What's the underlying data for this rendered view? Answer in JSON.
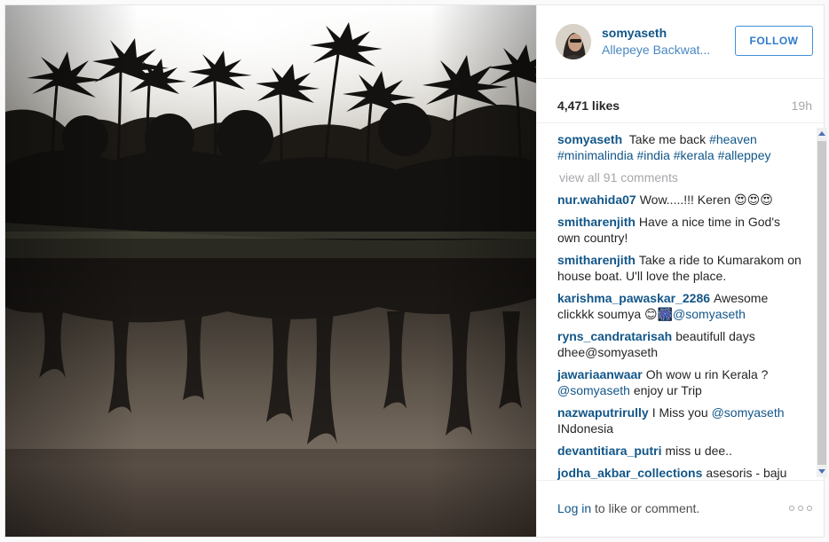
{
  "post": {
    "photo_alt": "Allepeye backwater palm trees reflection",
    "username": "somyaseth",
    "location": "Allepeye Backwat...",
    "follow_label": "FOLLOW",
    "likes": "4,471 likes",
    "time": "19h"
  },
  "caption": {
    "user": "somyaseth",
    "text_before": "Take me back",
    "tags": [
      "#heaven",
      "#minimalindia",
      "#india",
      "#kerala",
      "#alleppey"
    ]
  },
  "view_all": "view all 91 comments",
  "comments": [
    {
      "user": "nur.wahida07",
      "text": "Wow.....!!! Keren 😍😍😍",
      "mention": ""
    },
    {
      "user": "smitharenjith",
      "text": "Have a nice time in God's own country!",
      "mention": ""
    },
    {
      "user": "smitharenjith",
      "text": "Take a ride to Kumarakom on house boat. U'll love the place.",
      "mention": ""
    },
    {
      "user": "karishma_pawaskar_2286",
      "text": "Awesome clickkk soumya 😊🎆",
      "mention": "@somyaseth"
    },
    {
      "user": "ryns_candratarisah",
      "text": "beautifull days dhee@somyaseth",
      "mention": ""
    },
    {
      "user": "jawariaanwaar",
      "text": "Oh wow u rin Kerala ?",
      "mention": "@somyaseth",
      "after": "enjoy ur Trip"
    },
    {
      "user": "nazwaputrirully",
      "text": "I Miss you",
      "mention": "@somyaseth",
      "after": "INdonesia"
    },
    {
      "user": "devantitiara_putri",
      "text": "miss u dee..",
      "mention": ""
    },
    {
      "user": "jodha_akbar_collections",
      "text": "asesoris - baju",
      "mention": ""
    }
  ],
  "footer": {
    "login_link": "Log in",
    "login_rest": " to like or comment."
  },
  "icons": {
    "more": "more-options-icon",
    "scroll_up": "scroll-up-arrow-icon",
    "scroll_down": "scroll-down-arrow-icon"
  },
  "colors": {
    "username": "#125688",
    "follow": "#2f7bc9",
    "muted": "#a5a7aa"
  }
}
